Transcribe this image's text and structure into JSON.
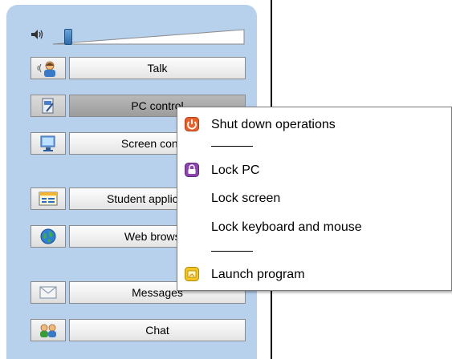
{
  "nav_buttons": [
    {
      "label": "Talk",
      "icon": "talk-person-icon"
    },
    {
      "label": "PC control",
      "icon": "pc-control-icon"
    },
    {
      "label": "Screen control",
      "icon": "screen-control-icon"
    },
    {
      "label": "Student applications",
      "icon": "student-apps-icon"
    },
    {
      "label": "Web browser",
      "icon": "globe-icon"
    },
    {
      "label": "Messages",
      "icon": "envelope-icon"
    },
    {
      "label": "Chat",
      "icon": "chat-people-icon"
    }
  ],
  "context_menu": {
    "items": [
      {
        "label": "Shut down operations",
        "icon": "power-icon"
      },
      {
        "label": "Lock PC",
        "icon": "lock-icon"
      },
      {
        "label": "Lock screen"
      },
      {
        "label": "Lock keyboard and mouse"
      },
      {
        "label": "Launch program",
        "icon": "launch-program-icon"
      }
    ]
  },
  "colors": {
    "panel": "#b7d0ec",
    "power_icon": "#e8602c",
    "lock_icon": "#8c44b0",
    "launch_icon": "#f3c422"
  }
}
